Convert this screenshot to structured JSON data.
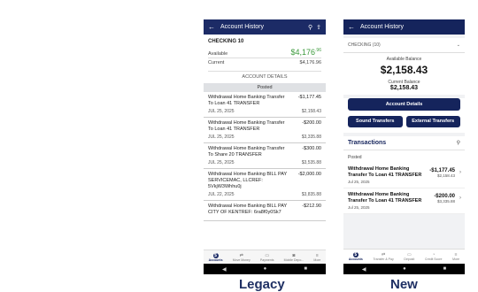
{
  "legacy": {
    "caption": "Legacy",
    "appbar": {
      "title": "Account History",
      "back_glyph": "←",
      "search_glyph": "⚲",
      "export_glyph": "⇪"
    },
    "account": {
      "name": "CHECKING 10",
      "available_label": "Available",
      "available_value": "$4,176",
      "available_cents": ".96",
      "current_label": "Current",
      "current_value": "$4,176.96"
    },
    "details_label": "ACCOUNT DETAILS",
    "posted_label": "Posted",
    "transactions": [
      {
        "desc": "Withdrawal Home Banking Transfer To Loan 41 TRANSFER",
        "amount": "-$1,177.45",
        "date": "JUL 25, 2025",
        "balance": "$2,158.43"
      },
      {
        "desc": "Withdrawal Home Banking Transfer To Loan 41 TRANSFER",
        "amount": "-$200.00",
        "date": "JUL 25, 2025",
        "balance": "$3,335.88"
      },
      {
        "desc": "Withdrawal Home Banking Transfer To Share 20 TRANSFER",
        "amount": "-$300.00",
        "date": "JUL 25, 2025",
        "balance": "$3,535.88"
      },
      {
        "desc": "Withdrawal Home Banking BILL PAY SERVICEMAC, LLCREF: 5VkjW3Whhu0j",
        "amount": "-$2,000.00",
        "date": "JUL 22, 2025",
        "balance": "$3,835.88"
      },
      {
        "desc": "Withdrawal Home Banking BILL PAY CITY OF KENTREF: 6ra8f0y0Sk7",
        "amount": "-$212.90",
        "date": "",
        "balance": ""
      }
    ],
    "tabs": [
      {
        "label": "Accounts",
        "glyph": "$",
        "active": true
      },
      {
        "label": "Move Money",
        "glyph": "⇄",
        "active": false
      },
      {
        "label": "Payments",
        "glyph": "▭",
        "active": false
      },
      {
        "label": "Mobile Depo...",
        "glyph": "◙",
        "active": false
      },
      {
        "label": "More",
        "glyph": "≡",
        "active": false
      }
    ],
    "sysnav": {
      "back": "◀",
      "home": "●",
      "recent": "■"
    }
  },
  "new": {
    "caption": "New",
    "appbar": {
      "title": "Account History",
      "back_glyph": "←"
    },
    "account_select": {
      "label": "CHECKING (10)",
      "chevron": "⌄"
    },
    "available_label": "Available Balance",
    "available_value": "$2,158.43",
    "current_label": "Current Balance",
    "current_value": "$2,158.43",
    "details_button": "Account Details",
    "sound_button": "Sound Transfers",
    "external_button": "External Transfers",
    "transactions_label": "Transactions",
    "search_glyph": "⚲",
    "posted_label": "Posted",
    "transactions": [
      {
        "desc": "Withdrawal Home Banking Transfer To Loan 41 TRANSFER",
        "date": "Jul 25, 2025",
        "amount": "-$1,177.45",
        "balance": "$2,158.43"
      },
      {
        "desc": "Withdrawal Home Banking Transfer To Loan 41 TRANSFER",
        "date": "Jul 25, 2025",
        "amount": "-$200.00",
        "balance": "$3,335.88"
      }
    ],
    "tabs": [
      {
        "label": "Accounts",
        "glyph": "$",
        "active": true
      },
      {
        "label": "Transfer & Pay",
        "glyph": "⇄",
        "active": false
      },
      {
        "label": "Deposit",
        "glyph": "▭",
        "active": false
      },
      {
        "label": "Credit Score",
        "glyph": "◔",
        "active": false
      },
      {
        "label": "More",
        "glyph": "≡",
        "active": false
      }
    ],
    "sysnav": {
      "back": "◀",
      "home": "●",
      "recent": "■"
    }
  }
}
